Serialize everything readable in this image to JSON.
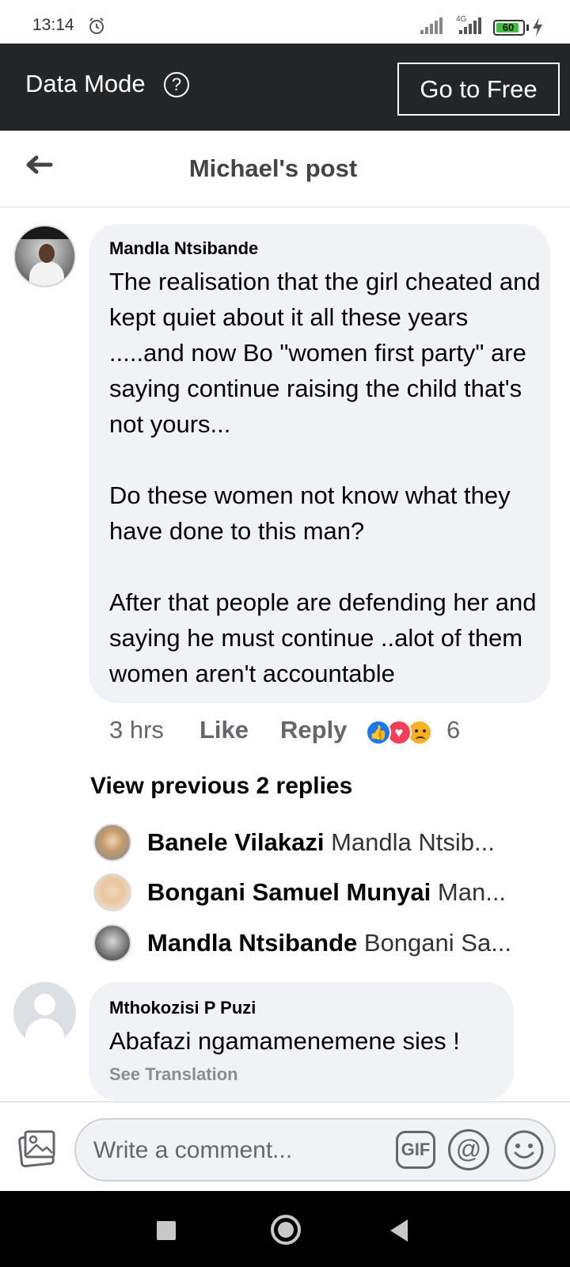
{
  "status_bar": {
    "time": "13:14",
    "network": "4G",
    "battery": "60"
  },
  "data_mode": {
    "title": "Data Mode",
    "help_symbol": "?",
    "go_free_label": "Go to Free"
  },
  "header": {
    "title": "Michael's post"
  },
  "comment": {
    "author": "Mandla Ntsibande",
    "text": "The realisation that the girl cheated and kept quiet about it all these years .....and now Bo \"women first party\" are saying continue raising the child that's not yours...\n\nDo these women not know what they have done to this man?\n\nAfter that people are defending her and saying he must continue ..alot of them women aren't accountable",
    "time": "3 hrs",
    "like_label": "Like",
    "reply_label": "Reply",
    "reaction_count": "6",
    "reactions": [
      "like",
      "love",
      "sad"
    ]
  },
  "replies": {
    "view_previous_label": "View previous 2 replies",
    "items": [
      {
        "name": "Banele Vilakazi",
        "preview": "Mandla Ntsib..."
      },
      {
        "name": "Bongani Samuel Munyai",
        "preview": "Man..."
      },
      {
        "name": "Mandla Ntsibande",
        "preview": "Bongani Sa..."
      }
    ]
  },
  "comment2": {
    "author": "Mthokozisi P Puzi",
    "text": "Abafazi ngamamenemene sies !",
    "see_translation": "See Translation"
  },
  "composer": {
    "placeholder": "Write a comment...",
    "gif_label": "GIF",
    "at_symbol": "@"
  },
  "colors": {
    "header_bg": "#242526",
    "bubble_bg": "#f0f2f5",
    "secondary_text": "#65676b",
    "like_blue": "#1877f2",
    "love_red": "#f33e58",
    "sad_yellow": "#f7b125"
  }
}
